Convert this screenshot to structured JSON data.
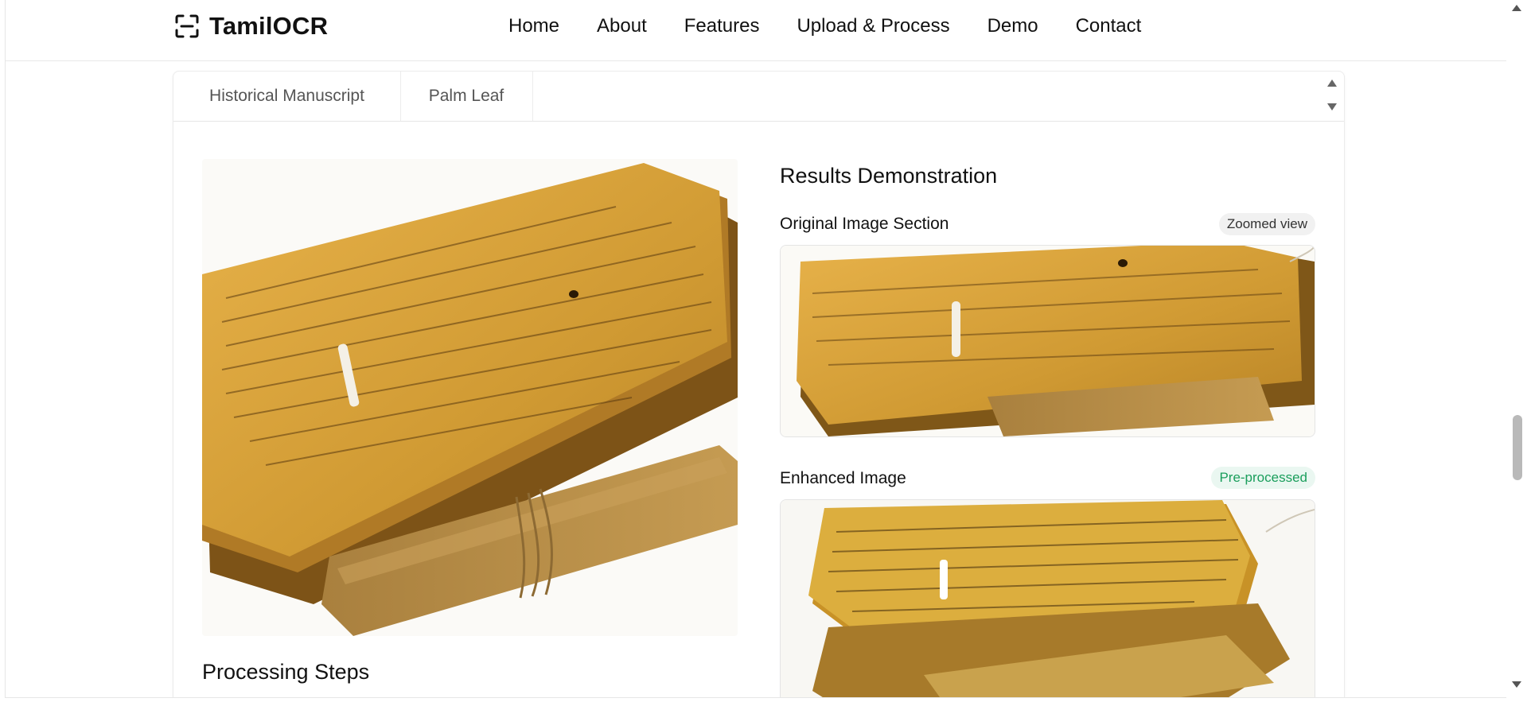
{
  "brand": {
    "name": "TamilOCR",
    "icon": "scan-frame-icon"
  },
  "nav": {
    "items": [
      {
        "label": "Home"
      },
      {
        "label": "About"
      },
      {
        "label": "Features"
      },
      {
        "label": "Upload & Process"
      },
      {
        "label": "Demo"
      },
      {
        "label": "Contact"
      }
    ]
  },
  "tabs": [
    {
      "label": "Historical Manuscript"
    },
    {
      "label": "Palm Leaf"
    }
  ],
  "processing": {
    "title": "Processing Steps"
  },
  "results": {
    "title": "Results Demonstration",
    "original": {
      "label": "Original Image Section",
      "badge": "Zoomed view"
    },
    "enhanced": {
      "label": "Enhanced Image",
      "badge": "Pre-processed"
    }
  },
  "colors": {
    "accent_green": "#1a9e5c",
    "leaf_gold": "#d9a93f",
    "leaf_dark": "#8a5a16"
  }
}
